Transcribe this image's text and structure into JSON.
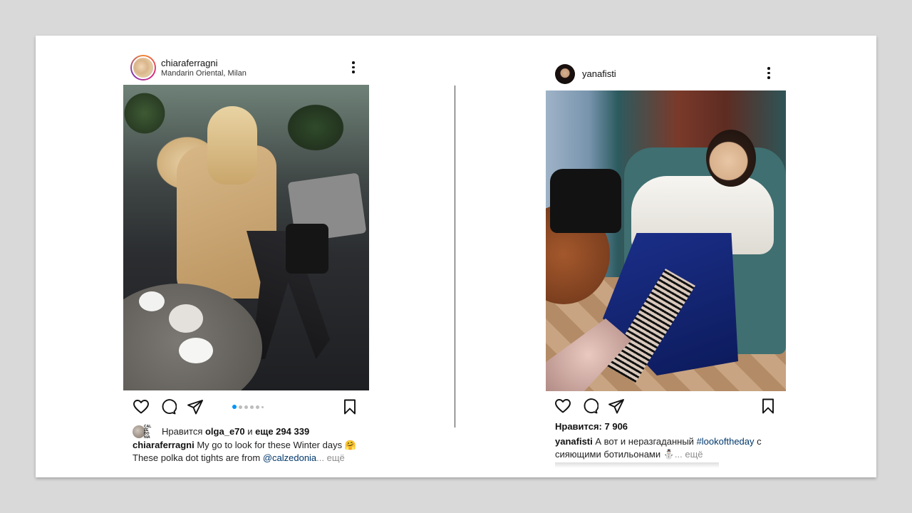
{
  "left_post": {
    "username": "chiaraferragni",
    "location": "Mandarin Oriental, Milan",
    "likes_prefix": "Нравится ",
    "likes_user": "olga_e70",
    "likes_mid": " и ",
    "likes_rest": "еще 294 339",
    "likes_avatar_text": "CAL ZE DO NIA",
    "caption_user": "chiaraferragni",
    "caption_text1": " My go to look for these Winter days 🤗",
    "caption_text2": "These polka dot tights are from ",
    "caption_mention": "@calzedonia",
    "caption_more": "... ещё",
    "carousel_total": 6,
    "carousel_active": 1
  },
  "right_post": {
    "username": "yanafisti",
    "likes": "Нравится: 7 906",
    "caption_user": "yanafisti",
    "caption_text1": " А вот и неразгаданный ",
    "caption_tag": "#lookoftheday",
    "caption_text2": " с",
    "caption_text3": "сияющими ботильонами ⛄",
    "caption_more": "... ещё"
  },
  "icons": {
    "like": "heart-icon",
    "comment": "comment-icon",
    "share": "paper-plane-icon",
    "save": "bookmark-icon",
    "menu": "more-vertical-icon"
  },
  "colors": {
    "link": "#00376b",
    "carousel_active": "#0095f6",
    "muted": "#8e8e8e"
  }
}
